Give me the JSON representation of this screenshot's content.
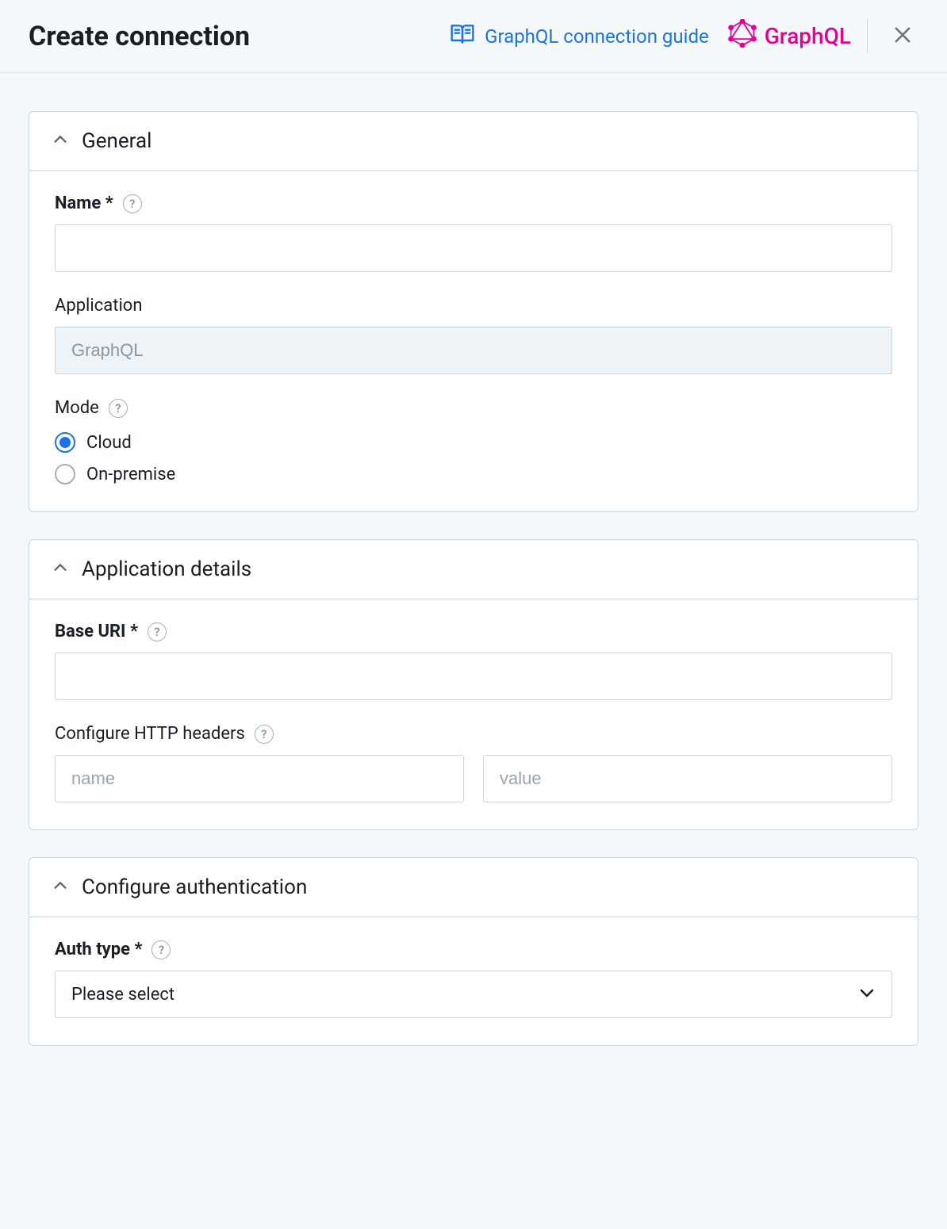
{
  "header": {
    "title": "Create connection",
    "guide_link": "GraphQL connection guide",
    "brand": "GraphQL"
  },
  "sections": {
    "general": {
      "title": "General",
      "name_label": "Name *",
      "name_value": "",
      "application_label": "Application",
      "application_value": "GraphQL",
      "mode_label": "Mode",
      "mode_options": {
        "cloud": "Cloud",
        "onprem": "On-premise"
      },
      "mode_selected": "cloud"
    },
    "appdetails": {
      "title": "Application details",
      "baseuri_label": "Base URI *",
      "baseuri_value": "",
      "headers_label": "Configure HTTP headers",
      "headers_name_placeholder": "name",
      "headers_value_placeholder": "value"
    },
    "auth": {
      "title": "Configure authentication",
      "authtype_label": "Auth type *",
      "authtype_value": "Please select"
    }
  }
}
